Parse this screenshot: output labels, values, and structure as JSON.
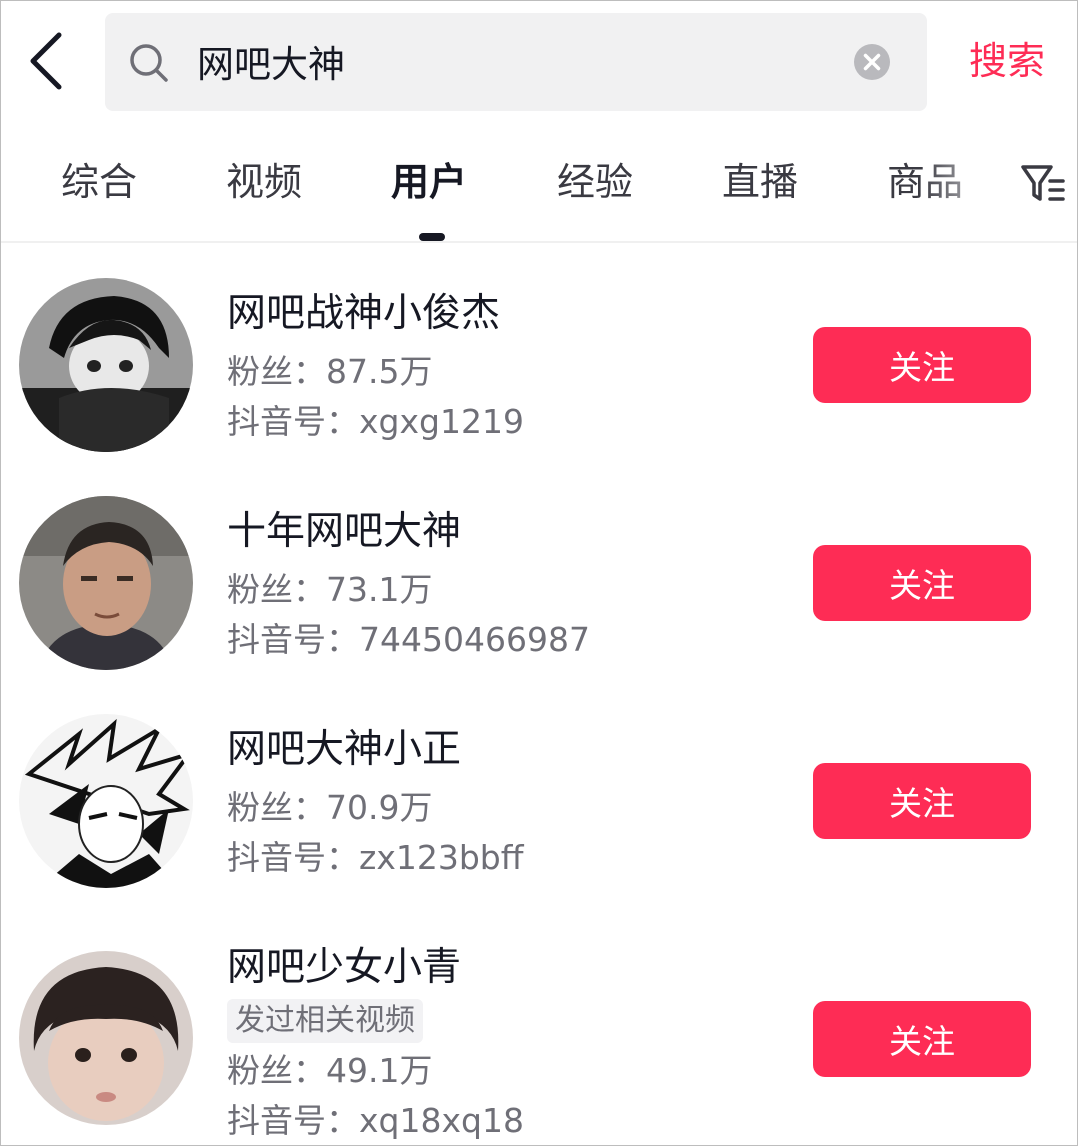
{
  "search": {
    "query": "网吧大神",
    "submit_label": "搜索"
  },
  "tabs": [
    {
      "label": "综合",
      "active": false
    },
    {
      "label": "视频",
      "active": false
    },
    {
      "label": "用户",
      "active": true
    },
    {
      "label": "经验",
      "active": false
    },
    {
      "label": "直播",
      "active": false
    },
    {
      "label": "商品",
      "active": false
    }
  ],
  "icons": {
    "back": "chevron-left-icon",
    "search": "search-icon",
    "clear": "clear-circle-icon",
    "filter": "filter-icon"
  },
  "colors": {
    "accent": "#fe2c55",
    "text_primary": "#161823",
    "text_secondary": "#6f6f77"
  },
  "results": [
    {
      "name": "网吧战神小俊杰",
      "tag": "",
      "fans": "粉丝：87.5万",
      "douyin_id": "抖音号：xgxg1219",
      "follow_label": "关注"
    },
    {
      "name": "十年网吧大神",
      "tag": "",
      "fans": "粉丝：73.1万",
      "douyin_id": "抖音号：74450466987",
      "follow_label": "关注"
    },
    {
      "name": "网吧大神小正",
      "tag": "",
      "fans": "粉丝：70.9万",
      "douyin_id": "抖音号：zx123bbff",
      "follow_label": "关注"
    },
    {
      "name": "网吧少女小青",
      "tag": "发过相关视频",
      "fans": "粉丝：49.1万",
      "douyin_id": "抖音号：xq18xq18",
      "follow_label": "关注"
    }
  ]
}
